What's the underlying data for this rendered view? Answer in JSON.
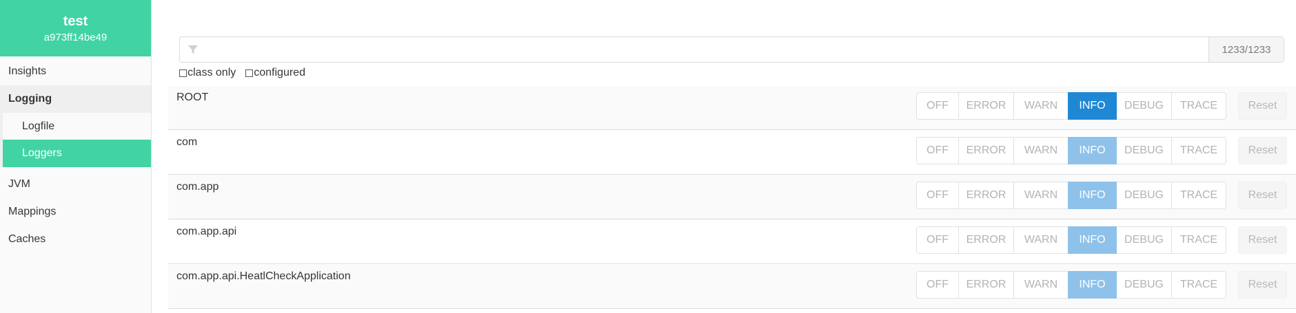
{
  "instance": {
    "name": "test",
    "id": "a973ff14be49"
  },
  "nav": {
    "insights": "Insights",
    "logging": "Logging",
    "logfile": "Logfile",
    "loggers": "Loggers",
    "jvm": "JVM",
    "mappings": "Mappings",
    "caches": "Caches"
  },
  "filter": {
    "placeholder": "",
    "value": "",
    "count": "1233/1233",
    "icon": "filter-icon"
  },
  "options": {
    "class_only": "class only",
    "configured": "configured"
  },
  "levels": [
    "OFF",
    "ERROR",
    "WARN",
    "INFO",
    "DEBUG",
    "TRACE"
  ],
  "reset_label": "Reset",
  "loggers": [
    {
      "name": "ROOT",
      "level": "INFO",
      "configured": true
    },
    {
      "name": "com",
      "level": "INFO",
      "configured": false
    },
    {
      "name": "com.app",
      "level": "INFO",
      "configured": false
    },
    {
      "name": "com.app.api",
      "level": "INFO",
      "configured": false
    },
    {
      "name": "com.app.api.HeatlCheckApplication",
      "level": "INFO",
      "configured": false
    }
  ],
  "colors": {
    "accent": "#42d3a5",
    "level_configured": "#1e88d5",
    "level_inherited": "#8ec2ea"
  }
}
